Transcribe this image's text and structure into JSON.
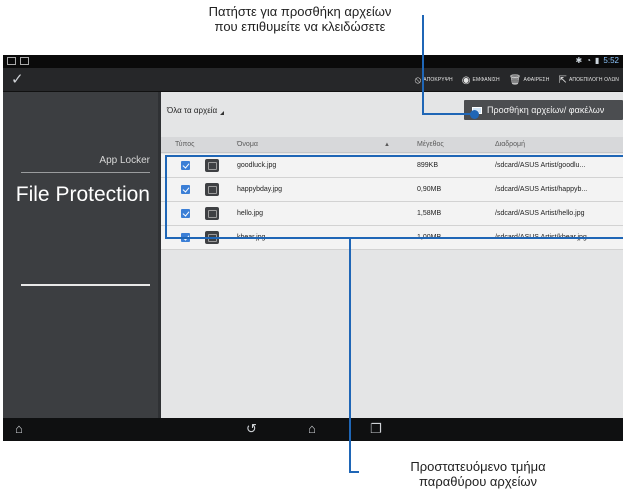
{
  "callouts": {
    "top_line1": "Πατήστε για προσθήκη αρχείων",
    "top_line2": "που επιθυμείτε να κλειδώσετε",
    "bottom_line1": "Προστατευόμενο τμήμα",
    "bottom_line2": "παραθύρου αρχείων"
  },
  "statusbar": {
    "time": "5:52",
    "icons": [
      "screenshot-icon",
      "gallery-icon",
      "bluetooth-icon",
      "wifi-icon",
      "battery-icon"
    ]
  },
  "actionbar": {
    "done_icon": "check-icon",
    "actions": [
      {
        "icon": "hide-icon",
        "glyph": "⦸",
        "label": "ΑΠΟΚΡΥΨΗ"
      },
      {
        "icon": "show-icon",
        "glyph": "◉",
        "label": "ΕΜΦΑΝΙΣΗ"
      },
      {
        "icon": "trash-icon",
        "glyph": "🗑",
        "label": "ΑΦΑΙΡΕΣΗ"
      },
      {
        "icon": "deselect-all-icon",
        "glyph": "⇱",
        "label": "ΑΠΟΕΠΙΛΟΓΗ ΟΛΩΝ"
      }
    ]
  },
  "sidebar": {
    "app_name": "App Locker",
    "title": "File Protection"
  },
  "content": {
    "filter_label": "Όλα τα αρχεία",
    "add_button_label": "Προσθήκη αρχείων/ φακέλων",
    "columns": {
      "type": "Τύπος",
      "name": "Όνομα",
      "size": "Μέγεθος",
      "path": "Διαδρομή"
    },
    "rows": [
      {
        "name": "goodluck.jpg",
        "size": "899KB",
        "path": "/sdcard/ASUS Artist/goodlu..."
      },
      {
        "name": "happybday.jpg",
        "size": "0,90MB",
        "path": "/sdcard/ASUS Artist/happyb..."
      },
      {
        "name": "hello.jpg",
        "size": "1,58MB",
        "path": "/sdcard/ASUS Artist/hello.jpg"
      },
      {
        "name": "kbear.jpg",
        "size": "1,00MB",
        "path": "/sdcard/ASUS Artist/kbear.jpg"
      }
    ]
  },
  "navbar": {
    "icons": [
      "home-shortcut-icon",
      "back-icon",
      "home-icon",
      "recent-apps-icon"
    ]
  },
  "colors": {
    "callout": "#1f66b6",
    "checkbox": "#3b7fd6"
  }
}
